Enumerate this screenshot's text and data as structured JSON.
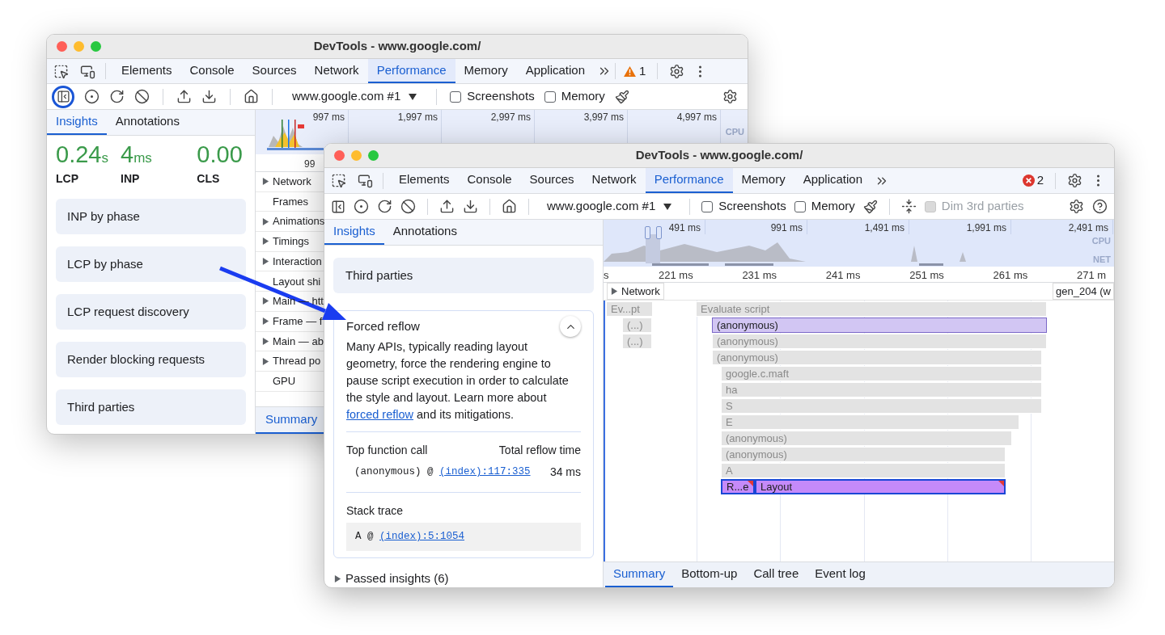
{
  "back_window": {
    "title": "DevTools - www.google.com/",
    "tabs": [
      {
        "label": "Elements",
        "selected": false
      },
      {
        "label": "Console",
        "selected": false
      },
      {
        "label": "Sources",
        "selected": false
      },
      {
        "label": "Network",
        "selected": false
      },
      {
        "label": "Performance",
        "selected": true
      },
      {
        "label": "Memory",
        "selected": false
      },
      {
        "label": "Application",
        "selected": false
      }
    ],
    "warning_count": "1",
    "toolbar": {
      "sidebar_toggle_highlighted": true,
      "target": "www.google.com #1",
      "checkboxes": [
        {
          "label": "Screenshots",
          "checked": false,
          "disabled": false
        },
        {
          "label": "Memory",
          "checked": false,
          "disabled": false
        }
      ]
    },
    "sidebar": {
      "tabs": [
        {
          "label": "Insights",
          "selected": true
        },
        {
          "label": "Annotations",
          "selected": false
        }
      ],
      "metrics": [
        {
          "value": "0.24",
          "unit": "s",
          "label": "LCP"
        },
        {
          "value": "4",
          "unit": "ms",
          "label": "INP"
        },
        {
          "value": "0.00",
          "label": "CLS"
        }
      ],
      "insights": [
        "INP by phase",
        "LCP by phase",
        "LCP request discovery",
        "Render blocking requests",
        "Third parties"
      ]
    },
    "timeline": {
      "overview_labels": [
        "997 ms",
        "1,997 ms",
        "2,997 ms",
        "3,997 ms",
        "4,997 ms"
      ],
      "overview_lane": "CPU",
      "ruler_label": "99",
      "tracks": [
        {
          "label": "Network",
          "expandable": true
        },
        {
          "label": "Frames",
          "expandable": false
        },
        {
          "label": "Animations",
          "expandable": true
        },
        {
          "label": "Timings",
          "expandable": true
        },
        {
          "label": "Interaction",
          "expandable": true
        },
        {
          "label": "Layout shi",
          "expandable": false
        },
        {
          "label": "Main — htt",
          "expandable": true
        },
        {
          "label": "Frame — f",
          "expandable": true
        },
        {
          "label": "Main — ab",
          "expandable": true
        },
        {
          "label": "Thread po",
          "expandable": true
        },
        {
          "label": "GPU",
          "expandable": false
        }
      ],
      "bottom_tabs": [
        {
          "label": "Summary",
          "selected": true
        }
      ]
    }
  },
  "front_window": {
    "title": "DevTools - www.google.com/",
    "tabs": [
      {
        "label": "Elements",
        "selected": false
      },
      {
        "label": "Console",
        "selected": false
      },
      {
        "label": "Sources",
        "selected": false
      },
      {
        "label": "Network",
        "selected": false
      },
      {
        "label": "Performance",
        "selected": true
      },
      {
        "label": "Memory",
        "selected": false
      },
      {
        "label": "Application",
        "selected": false
      }
    ],
    "error_count": "2",
    "toolbar": {
      "target": "www.google.com #1",
      "checkboxes": [
        {
          "label": "Screenshots",
          "checked": false,
          "disabled": false
        },
        {
          "label": "Memory",
          "checked": false,
          "disabled": false
        },
        {
          "label": "Dim 3rd parties",
          "checked": false,
          "disabled": true
        }
      ]
    },
    "sidebar": {
      "tabs": [
        {
          "label": "Insights",
          "selected": true
        },
        {
          "label": "Annotations",
          "selected": false
        }
      ],
      "insights": [
        {
          "title": "Third parties",
          "expanded": false
        },
        {
          "title": "Forced reflow",
          "expanded": true,
          "description_before": "Many APIs, typically reading layout geometry, force the rendering engine to pause script execution in order to calculate the style and layout. Learn more about ",
          "link": "forced reflow",
          "description_after": " and its mitigations.",
          "table": {
            "columns": [
              "Top function call",
              "Total reflow time"
            ],
            "call": "(anonymous) @ ",
            "call_link": "(index):117:335",
            "time": "34 ms"
          },
          "stack_trace": {
            "title": "Stack trace",
            "frame": "A @ ",
            "frame_link": "(index):5:1054"
          }
        }
      ],
      "passed": {
        "label": "Passed insights (6)",
        "expanded": false
      }
    },
    "timeline": {
      "overview_labels": [
        "491 ms",
        "991 ms",
        "1,491 ms",
        "1,991 ms",
        "2,491 ms"
      ],
      "overview_lanes": [
        "CPU",
        "NET"
      ],
      "ruler_labels": [
        "s",
        "221 ms",
        "231 ms",
        "241 ms",
        "251 ms",
        "261 ms",
        "271 m"
      ],
      "network_track": {
        "label": "Network",
        "expandable": true,
        "event": "gen_204 (w"
      },
      "flame_rows": [
        {
          "entries": [
            {
              "label": "Ev...pt",
              "kind": "script",
              "selected": false
            },
            {
              "label": "Evaluate script",
              "kind": "script",
              "selected": false
            }
          ]
        },
        {
          "entries": [
            {
              "label": "(...)",
              "kind": "script",
              "selected": false
            },
            {
              "label": "(anonymous)",
              "kind": "script",
              "selected": true
            }
          ]
        },
        {
          "entries": [
            {
              "label": "(...)",
              "kind": "script",
              "selected": false
            },
            {
              "label": "(anonymous)",
              "kind": "script",
              "selected": false
            }
          ]
        },
        {
          "entries": [
            {
              "label": "(anonymous)",
              "kind": "script",
              "selected": false
            }
          ]
        },
        {
          "entries": [
            {
              "label": "google.c.maft",
              "kind": "script",
              "selected": false
            }
          ]
        },
        {
          "entries": [
            {
              "label": "ha",
              "kind": "script",
              "selected": false
            }
          ]
        },
        {
          "entries": [
            {
              "label": "S",
              "kind": "script",
              "selected": false
            }
          ]
        },
        {
          "entries": [
            {
              "label": "E",
              "kind": "script",
              "selected": false
            }
          ]
        },
        {
          "entries": [
            {
              "label": "(anonymous)",
              "kind": "script",
              "selected": false
            }
          ]
        },
        {
          "entries": [
            {
              "label": "(anonymous)",
              "kind": "script",
              "selected": false
            }
          ]
        },
        {
          "entries": [
            {
              "label": "A",
              "kind": "script",
              "selected": false
            }
          ]
        },
        {
          "entries": [
            {
              "label": "R...e",
              "kind": "rendering",
              "selected": true,
              "warning": true
            },
            {
              "label": "Layout",
              "kind": "rendering",
              "selected": true,
              "warning": true
            }
          ]
        }
      ],
      "bottom_tabs": [
        {
          "label": "Summary",
          "selected": true
        },
        {
          "label": "Bottom-up",
          "selected": false
        },
        {
          "label": "Call tree",
          "selected": false
        },
        {
          "label": "Event log",
          "selected": false
        }
      ]
    }
  }
}
